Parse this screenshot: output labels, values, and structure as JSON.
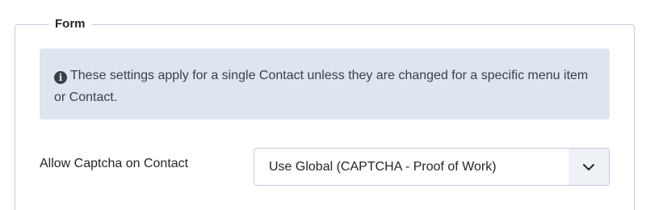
{
  "fieldset": {
    "legend": "Form"
  },
  "alert": {
    "icon": "info-circle-icon",
    "text": "These settings apply for a single Contact unless they are changed for a specific menu item or Contact."
  },
  "captcha_field": {
    "label": "Allow Captcha on Contact",
    "selected_value": "Use Global (CAPTCHA - Proof of Work)"
  }
}
